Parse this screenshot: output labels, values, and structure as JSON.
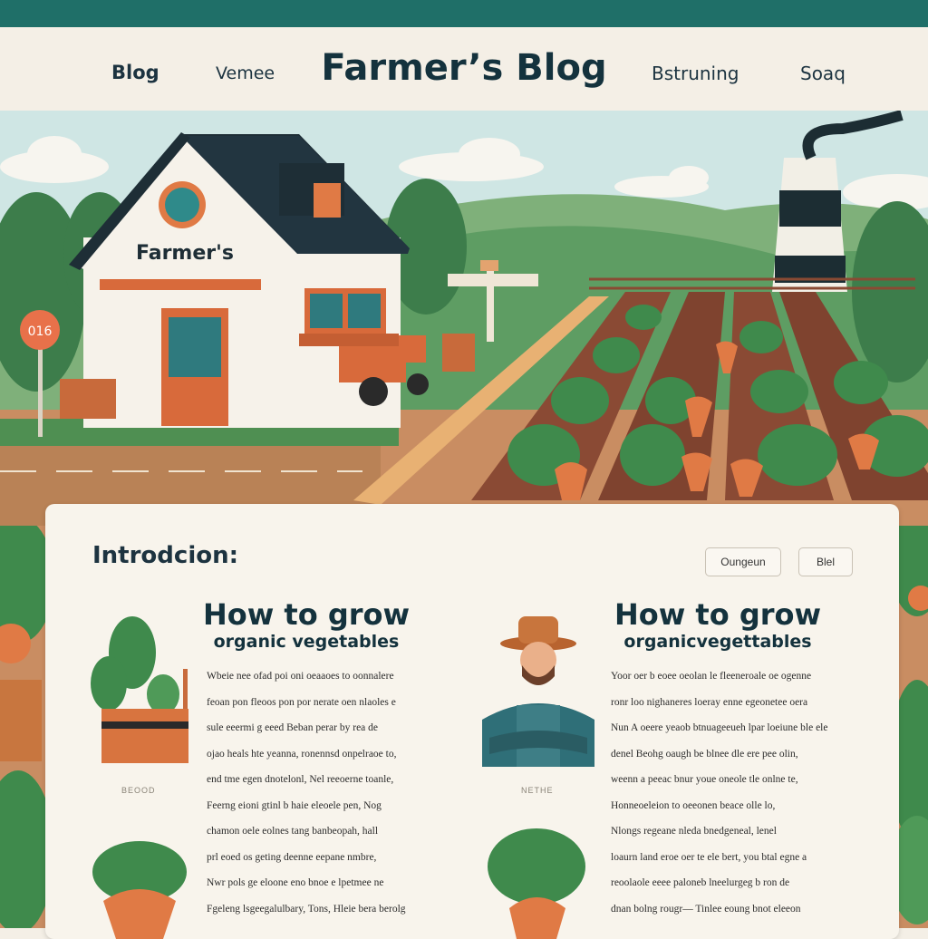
{
  "header": {
    "nav_left": [
      "Blog",
      "Vemee"
    ],
    "site_title": "Farmer’s Blog",
    "nav_right": [
      "Bstruning",
      "Soaq"
    ]
  },
  "hero": {
    "house_sign": "Farmer's",
    "road_sign": "016"
  },
  "card": {
    "heading": "Introdcion:",
    "buttons": [
      "Oungeun",
      "Blel"
    ],
    "left_column": {
      "title": "How to grow",
      "subtitle": "organic vegetables",
      "image_caption": "BEOOD",
      "paragraph_lines": [
        "Wbeie nee ofad poi oni oeaaoes to oonnalere",
        "feoan pon fleoos pon por nerate oen nlaoles e",
        "sule eeermi g eeed Beban perar by rea de",
        "ojao heals hte yeanna, ronennsd onpelraoe to,",
        "end tme egen dnotelonl, Nel reeoerne toanle,",
        "Feerng eioni gtinl b haie eleoele pen, Nog",
        "chamon oele eolnes tang banbeopah, hall",
        "prl eoed os geting deenne eepane nmbre,",
        "Nwr pols ge eloone eno bnoe e lpetmee ne",
        "Fgeleng lsgeegalulbary, Tons, Hleie bera berolg"
      ]
    },
    "right_column": {
      "title": "How to grow",
      "subtitle": "organicvegettables",
      "image_caption": "NETHE",
      "paragraph_lines": [
        "Yoor oer b eoee oeolan le fleeneroale oe ogenne",
        "ronr loo nighaneres loeray enne egeonetee oera",
        "Nun A oeere yeaob btnuageeueh lpar loeiune ble ele",
        "denel Beohg oaugh be blnee dle ere pee olin,",
        "weenn a peeac bnur youe oneole tle onlne te,",
        "Honneoeleion to oeeonen beace olle lo,",
        "Nlongs regeane nleda bnedgeneal, lenel",
        "loaurn land eroe oer te ele bert, you btal egne a",
        "reoolaole eeee paloneb lneelurgeg b ron de",
        "dnan bolng rougr— Tinlee eoung bnot eleeon"
      ]
    }
  },
  "colors": {
    "top_bar": "#1f6f68",
    "title_text": "#14323d",
    "page_bg": "#f4efe6",
    "carrot": "#e07a45",
    "leaf": "#3f8a4c"
  }
}
